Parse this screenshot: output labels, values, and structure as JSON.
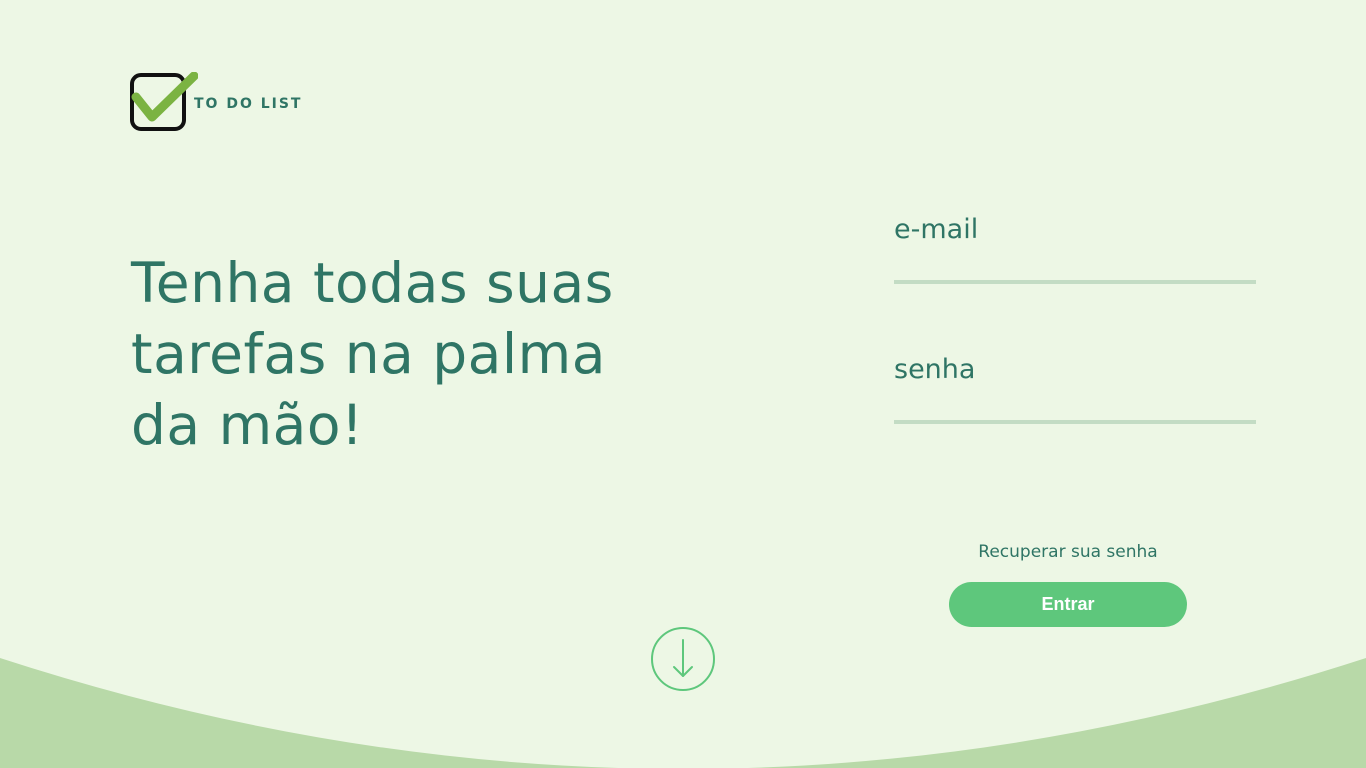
{
  "app": {
    "logo_text": "TO DO LIST"
  },
  "hero": {
    "title": "Tenha todas suas tarefas na palma da mão!"
  },
  "login_form": {
    "email_label": "e-mail",
    "password_label": "senha",
    "recover_password_link": "Recuperar sua senha",
    "submit_label": "Entrar"
  },
  "icons": {
    "logo": "checkbox-check-icon",
    "scroll": "arrow-down-circle-icon"
  },
  "colors": {
    "background": "#edf7e5",
    "accent_green": "#5ec77c",
    "text_teal": "#2f7565",
    "wave": "#b8d9a8",
    "input_underline": "#c3dcc4",
    "check_green": "#7bb342"
  }
}
